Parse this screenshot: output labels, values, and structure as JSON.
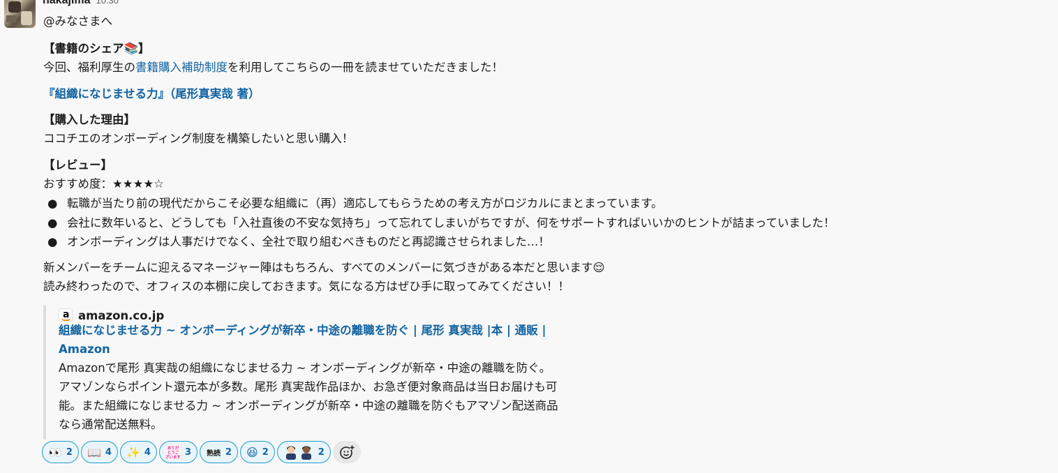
{
  "message": {
    "sender": "nakajima",
    "time": "10:30",
    "greeting": "@みなさまへ",
    "section_share": "【書籍のシェア",
    "section_share_emoji": "📚",
    "section_share_close": "】",
    "intro_pre": "今回、福利厚生の",
    "intro_link": "書籍購入補助制度",
    "intro_post": "を利用してこちらの一冊を読ませていただきました！",
    "book_title": "『組織になじませる力』（尾形真実哉 著）",
    "section_reason": "【購入した理由】",
    "reason": " ココチエのオンボーディング制度を構築したいと思い購入！",
    "section_review": "【レビュー】",
    "rating": "おすすめ度：★★★★☆",
    "bullets": [
      "転職が当たり前の現代だからこそ必要な組織に（再）適応してもらうための考え方がロジカルにまとまっています。",
      "会社に数年いると、どうしても「入社直後の不安な気持ち」って忘れてしまいがちですが、何をサポートすればいいかのヒントが詰まっていました！",
      "オンボーディングは人事だけでなく、全社で取り組むべきものだと再認識させられました…！"
    ],
    "closing1": " 新メンバーをチームに迎えるマネージャー陣はもちろん、すべてのメンバーに気づきがある本だと思います",
    "closing1_emoji": "😌",
    "closing2": "読み終わったので、オフィスの本棚に戻しておきます。気になる方はぜひ手に取ってみてください！！"
  },
  "unfurl": {
    "site": "amazon.co.jp",
    "title": "組織になじませる力 ~ オンボーディングが新卒・中途の離職を防ぐ | 尾形 真実哉 |本 | 通販 | Amazon",
    "description": "Amazonで尾形 真実哉の組織になじませる力 ~ オンボーディングが新卒・中途の離職を防ぐ。アマゾンならポイント還元本が多数。尾形 真実哉作品ほか、お急ぎ便対象商品は当日お届けも可能。また組織になじませる力 ~ オンボーディングが新卒・中途の離職を防ぐもアマゾン配送商品なら通常配送無料。"
  },
  "reactions": [
    {
      "emoji": "👀",
      "count": "2"
    },
    {
      "emoji": "📖",
      "count": "4"
    },
    {
      "emoji": "✨",
      "count": "4"
    },
    {
      "emoji": "ありがとうございます",
      "count": "3"
    },
    {
      "emoji": "熟読",
      "count": "2"
    },
    {
      "emoji": "😆",
      "count": "2"
    },
    {
      "emoji": "👩🏻‍💼👩🏾‍💼",
      "count": "2"
    }
  ],
  "colors": {
    "link": "#1264a3",
    "reaction_border": "#1d9bd1",
    "reaction_bg": "#e8f5fa"
  }
}
